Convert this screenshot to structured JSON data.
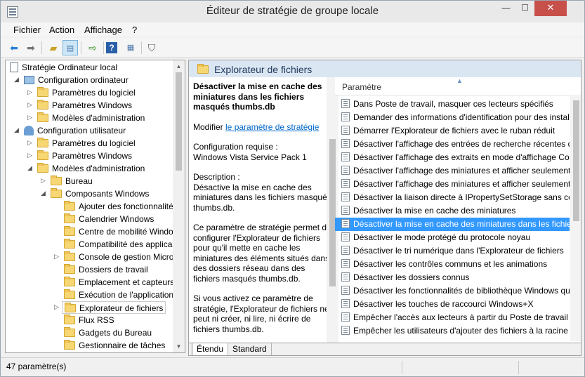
{
  "window": {
    "title": "Éditeur de stratégie de groupe locale",
    "minimize": "—",
    "maximize": "☐",
    "close": "✕"
  },
  "menu": [
    "Fichier",
    "Action",
    "Affichage",
    "?"
  ],
  "toolbar": [
    "back-icon",
    "forward-icon",
    "up-folder-icon",
    "show-hide-tree-icon",
    "export-list-icon",
    "help-icon",
    "properties-icon",
    "filter-icon"
  ],
  "tree": {
    "root": "Stratégie Ordinateur local",
    "computer_config": "Configuration ordinateur",
    "computer_items": [
      "Paramètres du logiciel",
      "Paramètres Windows",
      "Modèles d'administration"
    ],
    "user_config": "Configuration utilisateur",
    "user_items": [
      "Paramètres du logiciel",
      "Paramètres Windows",
      "Modèles d'administration"
    ],
    "bureau": "Bureau",
    "composants": "Composants Windows",
    "components": [
      "Ajouter des fonctionnalité",
      "Calendrier Windows",
      "Centre de mobilité Windo",
      "Compatibilité des applica",
      "Console de gestion Micro",
      "Dossiers de travail",
      "Emplacement et capteurs",
      "Exécution de l'application",
      "Explorateur de fichiers",
      "Flux RSS",
      "Gadgets du Bureau",
      "Gestionnaire de tâches"
    ]
  },
  "pane": {
    "header": "Explorateur de fichiers",
    "desc_title": "Désactiver la mise en cache des miniatures dans les fichiers masqués thumbs.db",
    "modify_prefix": "Modifier ",
    "modify_link": "le paramètre de stratégie",
    "requirements": "Configuration requise :",
    "requirements_value": "Windows Vista Service Pack 1",
    "desc_label": "Description :",
    "desc_text": "Désactive la mise en cache des miniatures dans les fichiers masqués thumbs.db.",
    "desc_para2": "Ce paramètre de stratégie permet de configurer l'Explorateur de fichiers pour qu'il mette en cache les miniatures des éléments situés dans des dossiers réseau dans des fichiers masqués thumbs.db.",
    "desc_para3": "Si vous activez ce paramètre de stratégie, l'Explorateur de fichiers ne peut ni créer, ni lire, ni écrire de fichiers thumbs.db."
  },
  "list": {
    "column": "Paramètre",
    "items": [
      "Dans Poste de travail, masquer ces lecteurs spécifiés",
      "Demander des informations d'identification pour des installations",
      "Démarrer l'Explorateur de fichiers avec le ruban réduit",
      "Désactiver l'affichage des entrées de recherche récentes dans la zone",
      "Désactiver l'affichage des extraits en mode d'affichage Contenu",
      "Désactiver l'affichage des miniatures et afficher seulement les icônes",
      "Désactiver l'affichage des miniatures et afficher seulement les icônes sur",
      "Désactiver la liaison directe à IPropertySetStorage sans conversion",
      "Désactiver la mise en cache des miniatures",
      "Désactiver la mise en cache des miniatures dans les fichiers masqués",
      "Désactiver le mode protégé du protocole noyau",
      "Désactiver le tri numérique dans l'Explorateur de fichiers",
      "Désactiver les contrôles communs et les animations",
      "Désactiver les dossiers connus",
      "Désactiver les fonctionnalités de bibliothèque Windows qui dépendent",
      "Désactiver les touches de raccourci Windows+X",
      "Empêcher l'accès aux lecteurs à partir du Poste de travail",
      "Empêcher les utilisateurs d'ajouter des fichiers à la racine de leur"
    ],
    "selected_index": 9
  },
  "tabs": [
    "Étendu",
    "Standard"
  ],
  "status": "47 paramètre(s)"
}
